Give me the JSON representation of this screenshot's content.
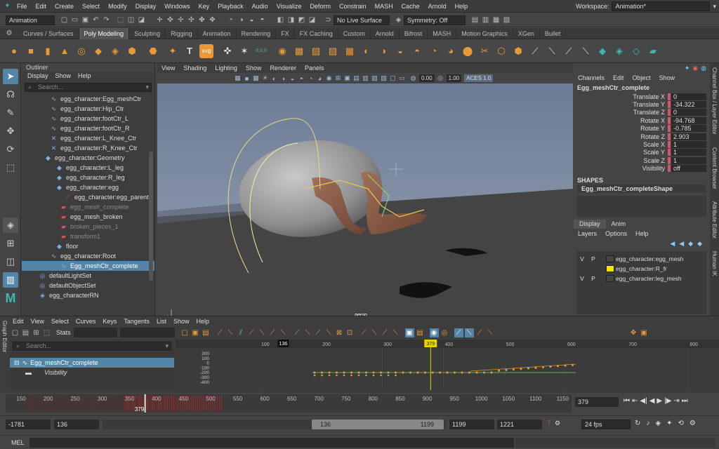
{
  "menubar": {
    "items": [
      "File",
      "Edit",
      "Create",
      "Select",
      "Modify",
      "Display",
      "Windows",
      "Key",
      "Playback",
      "Audio",
      "Visualize",
      "Deform",
      "Constrain",
      "MASH",
      "Cache",
      "Arnold",
      "Help"
    ],
    "workspace_label": "Workspace:",
    "workspace_value": "Animation*"
  },
  "statusline": {
    "menu_set": "Animation",
    "live_surface": "No Live Surface",
    "symmetry": "Symmetry: Off"
  },
  "shelf": {
    "tabs": [
      "Curves / Surfaces",
      "Poly Modeling",
      "Sculpting",
      "Rigging",
      "Animation",
      "Rendering",
      "FX",
      "FX Caching",
      "Custom",
      "Arnold",
      "Bifrost",
      "MASH",
      "Motion Graphics",
      "XGen",
      "Bullet"
    ],
    "active_tab": 1,
    "text_icons": {
      "T": "T",
      "svg": "svg",
      "zero": "0,0,0"
    }
  },
  "outliner": {
    "title": "Outliner",
    "menu": [
      "Display",
      "Show",
      "Help"
    ],
    "search_placeholder": "Search...",
    "rows": [
      {
        "label": "egg_character:Egg_meshCtr",
        "indent": 40,
        "icon": "curve-icon",
        "state": "normal"
      },
      {
        "label": "egg_character:Hip_Ctr",
        "indent": 40,
        "icon": "curve-icon",
        "state": "normal"
      },
      {
        "label": "egg_character:footCtr_L",
        "indent": 40,
        "icon": "curve-icon",
        "state": "normal"
      },
      {
        "label": "egg_character:footCtr_R",
        "indent": 40,
        "icon": "curve-icon",
        "state": "normal"
      },
      {
        "label": "egg_character:L_Knee_Ctr",
        "indent": 40,
        "icon": "joint-icon",
        "state": "normal"
      },
      {
        "label": "egg_character:R_Knee_Ctr",
        "indent": 40,
        "icon": "joint-icon",
        "state": "normal"
      },
      {
        "label": "egg_character:Geometry",
        "indent": 32,
        "icon": "group-icon",
        "state": "normal"
      },
      {
        "label": "egg_character:L_leg",
        "indent": 48,
        "icon": "group-icon",
        "state": "normal"
      },
      {
        "label": "egg_character:R_leg",
        "indent": 48,
        "icon": "group-icon",
        "state": "normal"
      },
      {
        "label": "egg_character:egg",
        "indent": 48,
        "icon": "group-icon",
        "state": "normal"
      },
      {
        "label": "egg_character:egg_parentC",
        "indent": 60,
        "icon": "constraint-icon",
        "state": "normal"
      },
      {
        "label": "egg_mesh_complete",
        "indent": 54,
        "icon": "mesh-icon",
        "state": "dim"
      },
      {
        "label": "egg_mesh_broken",
        "indent": 54,
        "icon": "mesh-icon",
        "state": "normal"
      },
      {
        "label": "broken_pieces_1",
        "indent": 54,
        "icon": "mesh-icon",
        "state": "dim"
      },
      {
        "label": "transform1",
        "indent": 54,
        "icon": "mesh-icon",
        "state": "dim"
      },
      {
        "label": "floor",
        "indent": 48,
        "icon": "group-icon",
        "state": "normal"
      },
      {
        "label": "egg_character:Root",
        "indent": 40,
        "icon": "curve-icon",
        "state": "normal"
      },
      {
        "label": "Egg_meshCtr_complete",
        "indent": 54,
        "icon": "curve-icon",
        "state": "selected"
      },
      {
        "label": "defaultLightSet",
        "indent": 24,
        "icon": "set-icon",
        "state": "normal"
      },
      {
        "label": "defaultObjectSet",
        "indent": 24,
        "icon": "set-icon",
        "state": "normal"
      },
      {
        "label": "egg_characterRN",
        "indent": 24,
        "icon": "reference-icon",
        "state": "normal"
      }
    ]
  },
  "viewport": {
    "menu": [
      "View",
      "Shading",
      "Lighting",
      "Show",
      "Renderer",
      "Panels"
    ],
    "field1": "0.00",
    "field2": "1.00",
    "colorspace": "ACES 1.0",
    "camera_label": "persp"
  },
  "channelbox": {
    "menu": [
      "Channels",
      "Edit",
      "Object",
      "Show"
    ],
    "node_name": "Egg_meshCtr_complete",
    "channels": [
      {
        "label": "Translate X",
        "value": "0"
      },
      {
        "label": "Translate Y",
        "value": "-34.322"
      },
      {
        "label": "Translate Z",
        "value": "0"
      },
      {
        "label": "Rotate X",
        "value": "-94.768"
      },
      {
        "label": "Rotate Y",
        "value": "-0.785"
      },
      {
        "label": "Rotate Z",
        "value": "2.903"
      },
      {
        "label": "Scale X",
        "value": "1"
      },
      {
        "label": "Scale Y",
        "value": "1"
      },
      {
        "label": "Scale Z",
        "value": "1"
      },
      {
        "label": "Visibility",
        "value": "off"
      }
    ],
    "shapes_title": "SHAPES",
    "shape_name": "Egg_meshCtr_completeShape",
    "layer_tabs": [
      "Display",
      "Anim"
    ],
    "layer_menu": [
      "Layers",
      "Options",
      "Help"
    ],
    "layers": [
      {
        "v": "V",
        "p": "P",
        "name": "egg_character:egg_mesh",
        "color": "#444444"
      },
      {
        "v": "",
        "p": "",
        "name": "egg_character:R_fr",
        "color": "#f2e600"
      },
      {
        "v": "V",
        "p": "P",
        "name": "egg_character:leg_mesh",
        "color": "#444444"
      }
    ],
    "side_tabs": [
      "Channel Box / Layer Editor",
      "Content Browser",
      "Attribute Editor",
      "Human IK"
    ]
  },
  "graph": {
    "side_label": "Graph Editor",
    "menu": [
      "Edit",
      "View",
      "Select",
      "Curves",
      "Keys",
      "Tangents",
      "List",
      "Show",
      "Help"
    ],
    "stats_label": "Stats",
    "search_placeholder": "Search...",
    "node": "Egg_meshCtr_complete",
    "attribute": "Visibility",
    "frame_labels": [
      "100",
      "200",
      "300",
      "400",
      "500",
      "600",
      "700",
      "800"
    ],
    "current_frame": "379",
    "range_start": "136",
    "value_labels": [
      "200",
      "100",
      "0",
      "-100",
      "-200",
      "-300",
      "-400"
    ]
  },
  "timeslider": {
    "tick_labels": [
      "150",
      "200",
      "250",
      "300",
      "350",
      "400",
      "450",
      "500",
      "550",
      "600",
      "650",
      "700",
      "750",
      "800",
      "850",
      "900",
      "950",
      "1000",
      "1050",
      "1100",
      "1150",
      "1200"
    ],
    "current_frame": "379",
    "current_field": "379"
  },
  "rangebar": {
    "anim_start": "-1781",
    "play_start": "136",
    "range_inner_start": "136",
    "range_inner_end": "1199",
    "play_end": "1199",
    "anim_end": "1221",
    "fps": "24 fps"
  },
  "melbar": {
    "label": "MEL"
  }
}
